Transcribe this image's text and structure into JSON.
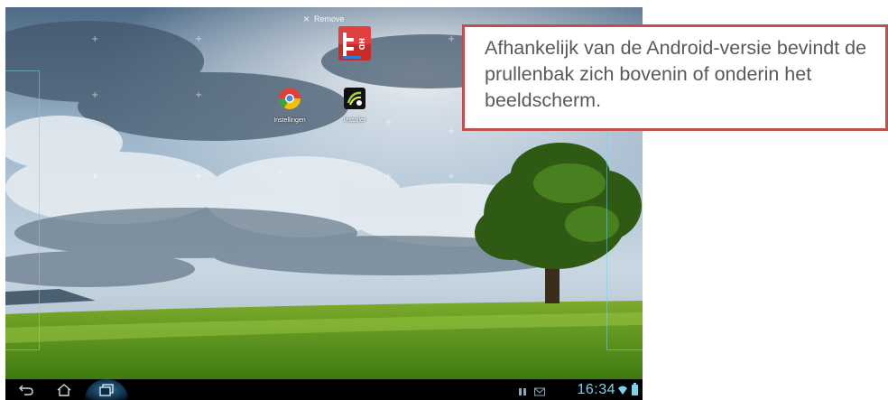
{
  "home_screen": {
    "remove_label": "Remove",
    "apps": [
      {
        "name": "Instellingen",
        "label": "Instellingen",
        "icon": "chrome-pie-icon"
      },
      {
        "name": "Installer",
        "label": "Installer",
        "icon": "package-installer-icon"
      }
    ],
    "dragged_app_icon": "hd-app-icon"
  },
  "status_bar": {
    "time": "16:34",
    "nav_icons": [
      "back-icon",
      "home-icon",
      "recent-apps-icon"
    ],
    "status_icons": [
      "notification-icon",
      "mail-icon",
      "wifi-icon",
      "battery-icon"
    ]
  },
  "callout": {
    "text": "Afhankelijk van de Android-versie bevindt de prullenbak zich bovenin of onderin het beeldscherm.",
    "border_color": "#c0504d",
    "text_color": "#595959"
  }
}
